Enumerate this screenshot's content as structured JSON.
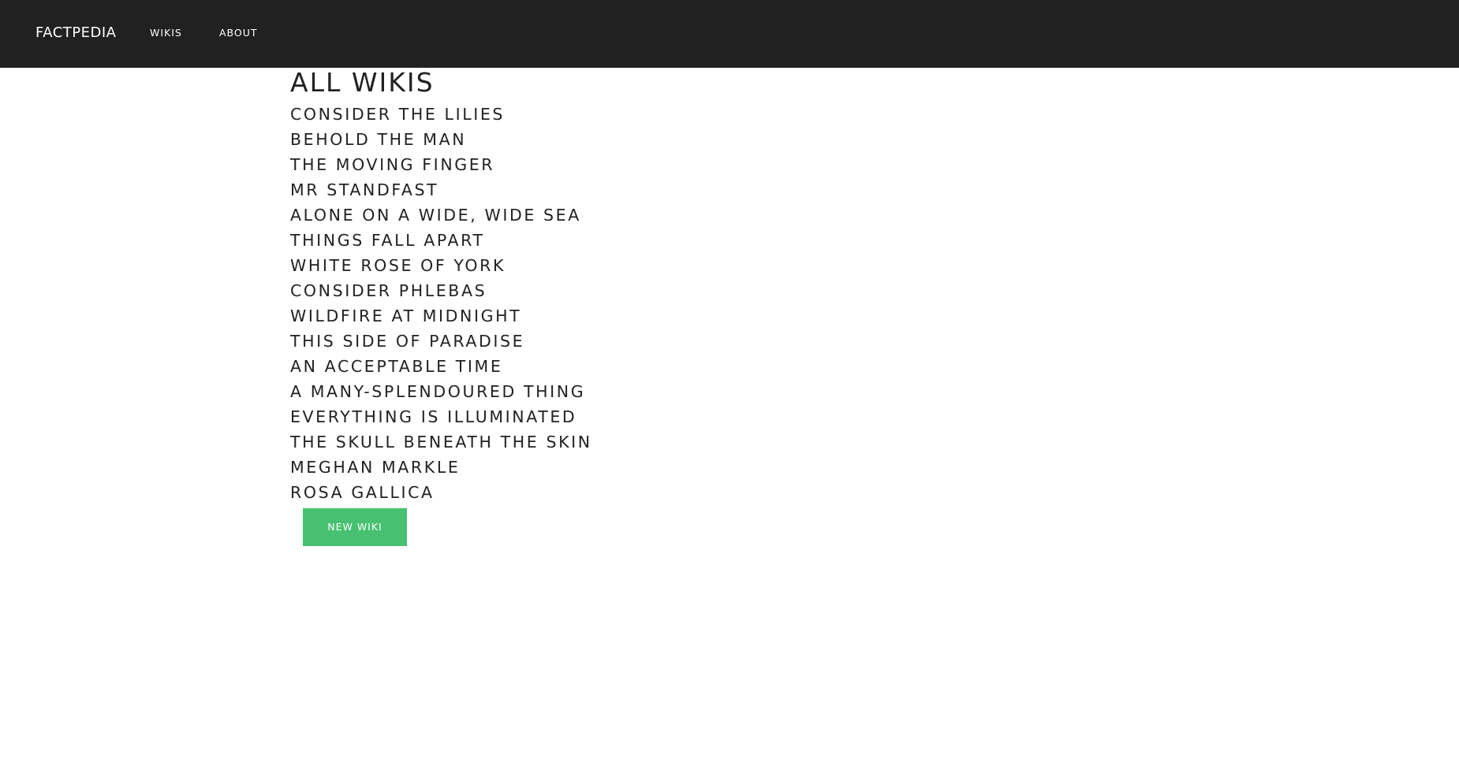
{
  "header": {
    "brand": "FACTPEDIA",
    "nav": [
      {
        "label": "WIKIS"
      },
      {
        "label": "ABOUT"
      }
    ]
  },
  "main": {
    "title": "ALL WIKIS",
    "wikis": [
      "CONSIDER THE LILIES",
      "BEHOLD THE MAN",
      "THE MOVING FINGER",
      "MR STANDFAST",
      "ALONE ON A WIDE, WIDE SEA",
      "THINGS FALL APART",
      "WHITE ROSE OF YORK",
      "CONSIDER PHLEBAS",
      "WILDFIRE AT MIDNIGHT",
      "THIS SIDE OF PARADISE",
      "AN ACCEPTABLE TIME",
      "A MANY-SPLENDOURED THING",
      "EVERYTHING IS ILLUMINATED",
      "THE SKULL BENEATH THE SKIN",
      "MEGHAN MARKLE",
      "ROSA GALLICA"
    ],
    "new_wiki_label": "NEW WIKI"
  },
  "colors": {
    "navbar_bg": "#212121",
    "button_bg": "#47c171",
    "text": "#222222"
  }
}
